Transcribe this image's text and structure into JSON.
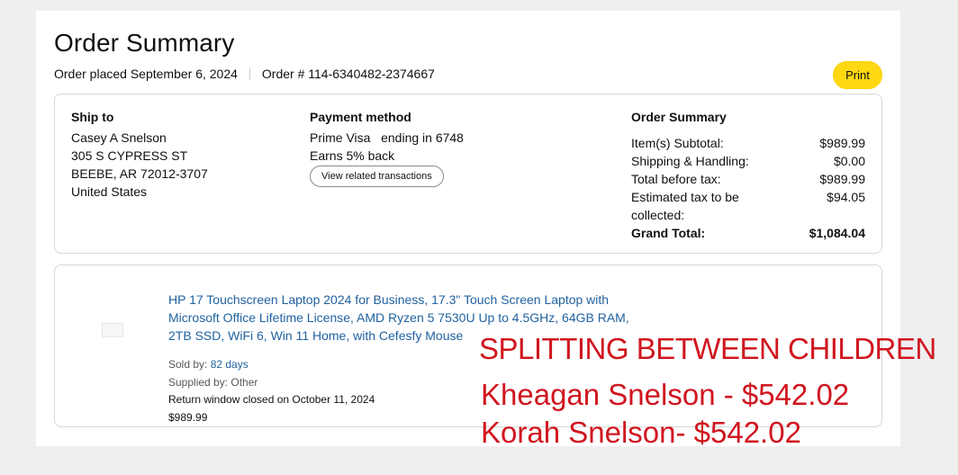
{
  "header": {
    "title": "Order Summary",
    "order_placed": "Order placed September 6, 2024",
    "order_number": "Order # 114-6340482-2374667",
    "print_label": "Print"
  },
  "ship_to": {
    "heading": "Ship to",
    "lines": [
      "Casey A Snelson",
      "305 S CYPRESS ST",
      "BEEBE, AR 72012-3707",
      "United States"
    ]
  },
  "payment": {
    "heading": "Payment method",
    "method": "Prime Visa   ending in 6748",
    "earns": "Earns 5% back",
    "view_button": "View related transactions"
  },
  "summary": {
    "heading": "Order Summary",
    "rows": [
      {
        "label": "Item(s) Subtotal:",
        "value": "$989.99"
      },
      {
        "label": "Shipping & Handling:",
        "value": "$0.00"
      },
      {
        "label": "Total before tax:",
        "value": "$989.99"
      },
      {
        "label": "Estimated tax to be collected:",
        "value": "$94.05"
      },
      {
        "label": "Grand Total:",
        "value": "$1,084.04"
      }
    ]
  },
  "item": {
    "title": "HP 17 Touchscreen Laptop 2024 for Business, 17.3\" Touch Screen Laptop with Microsoft Office Lifetime License, AMD Ryzen 5 7530U Up to 4.5GHz, 64GB RAM, 2TB SSD, WiFi 6, Win 11 Home, with Cefesfy Mouse",
    "sold_by_label": "Sold by:",
    "sold_by": "82 days",
    "supplied_by": "Supplied by: Other",
    "return_window": "Return window closed on October 11, 2024",
    "price": "$989.99"
  },
  "annotations": {
    "line1": "SPLITTING BETWEEN CHILDREN",
    "line2": "Kheagan Snelson - $542.02",
    "line3": "Korah Snelson- $542.02",
    "color": "#d0161f"
  },
  "colors": {
    "print_button": "#ffd814",
    "link": "#2162a1",
    "border": "#d5d9d9"
  }
}
